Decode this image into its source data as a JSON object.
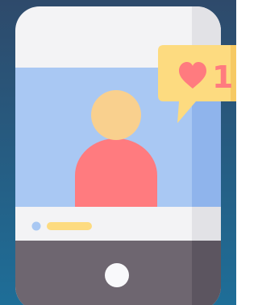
{
  "scene": {
    "subject": "smartphone-social-post-illustration"
  },
  "notification": {
    "icon": "heart-icon",
    "count": "1"
  },
  "post": {
    "avatar_icon": "user-avatar-icon",
    "caption_dot_icon": "caption-dot-icon",
    "caption_line_icon": "caption-placeholder-line"
  },
  "device": {
    "home_button_icon": "home-button-icon"
  },
  "colors": {
    "background_top": "#2e4a6b",
    "background_bottom": "#1e6e98",
    "phone_body": "#f3f3f5",
    "phone_edge": "#e2e2e6",
    "phone_bottom": "#6e6670",
    "phone_bottom_right": "#5c5560",
    "screen": "#a9c8f3",
    "screen_right_strip": "#8fb4ec",
    "avatar_head": "#f9d08e",
    "avatar_body": "#ff7b7f",
    "caption_dot": "#a9c8f3",
    "caption_line": "#fddb80",
    "bubble": "#fddb80",
    "bubble_shade": "#f6c963",
    "heart": "#ff7b7f",
    "count_text": "#ff7b7f",
    "home_button": "#f9f9fb"
  }
}
